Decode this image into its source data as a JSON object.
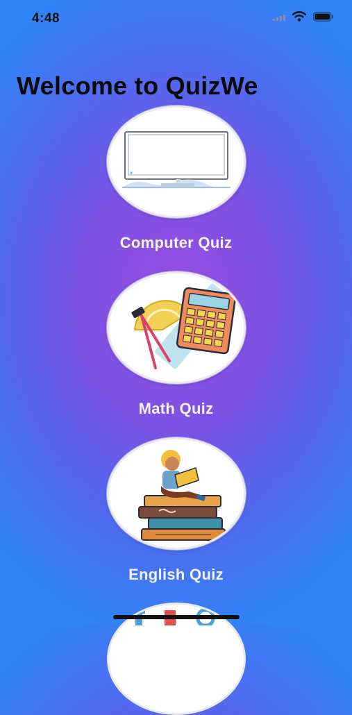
{
  "status_bar": {
    "time": "4:48"
  },
  "header": {
    "title": "Welcome to QuizWe"
  },
  "quizzes": [
    {
      "label": "Computer Quiz",
      "icon": "computer-monitor-icon"
    },
    {
      "label": "Math Quiz",
      "icon": "math-tools-calculator-icon"
    },
    {
      "label": "English Quiz",
      "icon": "reading-books-icon"
    },
    {
      "label": "",
      "icon": "partial-quiz-icon"
    }
  ],
  "colors": {
    "background_center": "#9a4ee0",
    "background_edge": "#2f86f7",
    "title_text": "#0b0b0b",
    "label_text": "#f4f4ff"
  }
}
